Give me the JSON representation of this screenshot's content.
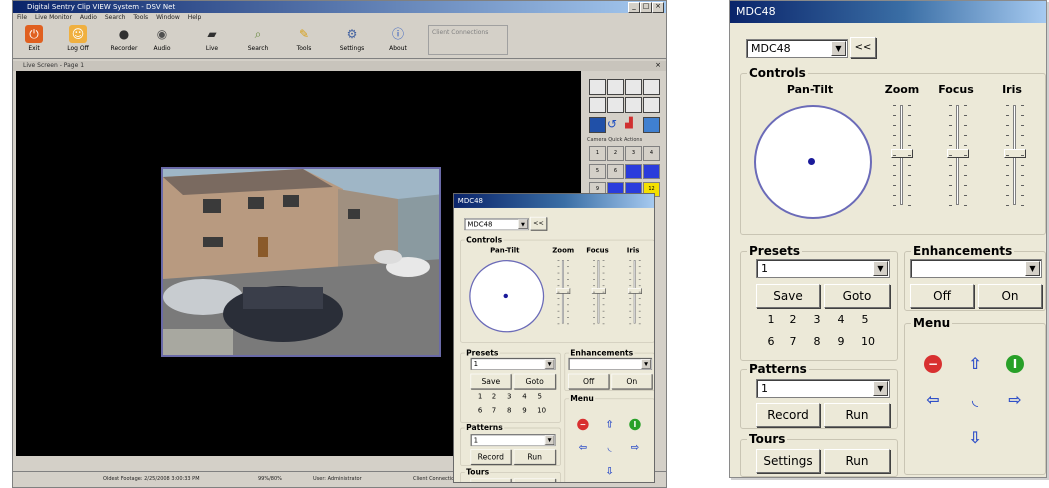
{
  "app": {
    "title": "Digital Sentry Clip VIEW System - DSV Net",
    "menu": [
      "File",
      "Live Monitor",
      "Audio",
      "Search",
      "Tools",
      "Window",
      "Help"
    ],
    "toolbar": [
      {
        "label": "Exit",
        "icon": "exit-icon",
        "color": "#e06020"
      },
      {
        "label": "Log Off",
        "icon": "logoff-icon",
        "color": "#f0a020"
      },
      {
        "label": "Recorder",
        "icon": "recorder-icon",
        "color": "#303030"
      },
      {
        "label": "Audio",
        "icon": "audio-icon",
        "color": "#505050"
      },
      {
        "label": "Live",
        "icon": "live-icon",
        "color": "#303030"
      },
      {
        "label": "Search",
        "icon": "search-icon",
        "color": "#6a8a40"
      },
      {
        "label": "Tools",
        "icon": "tools-icon",
        "color": "#e0b020"
      },
      {
        "label": "Settings",
        "icon": "settings-icon",
        "color": "#4060a0"
      },
      {
        "label": "About",
        "icon": "about-icon",
        "color": "#2050c0"
      }
    ],
    "client_connections": "Client Connections",
    "live_screen_title": "Live Screen - Page 1",
    "camera_quick_actions": "Camera Quick Actions",
    "quick_actions": [
      "1",
      "2",
      "3",
      "4",
      "5",
      "6",
      "",
      "",
      "9",
      "",
      "",
      "12"
    ],
    "status": {
      "storage": "Oldest Footage: 2/25/2008 3:00:33 PM",
      "rate": "99%/80%",
      "user": "User: Administrator",
      "client": "Client Connections"
    }
  },
  "dialog": {
    "title": "MDC48",
    "camera": "MDC48",
    "collapse_label": "<<",
    "controls_label": "Controls",
    "pantilt_label": "Pan-Tilt",
    "zoom_label": "Zoom",
    "focus_label": "Focus",
    "iris_label": "Iris",
    "presets_label": "Presets",
    "preset_value": "1",
    "save_label": "Save",
    "goto_label": "Goto",
    "preset_numbers": [
      "1",
      "2",
      "3",
      "4",
      "5",
      "6",
      "7",
      "8",
      "9",
      "10"
    ],
    "enhancements_label": "Enhancements",
    "enhancement_value": "",
    "off_label": "Off",
    "on_label": "On",
    "patterns_label": "Patterns",
    "pattern_value": "1",
    "record_label": "Record",
    "run_label": "Run",
    "tours_label": "Tours",
    "settings_label": "Settings",
    "tour_run_label": "Run",
    "menu_label": "Menu",
    "menu_colors": {
      "cancel": "#d83030",
      "ok": "#28a028",
      "arrow": "#3050c8"
    }
  }
}
